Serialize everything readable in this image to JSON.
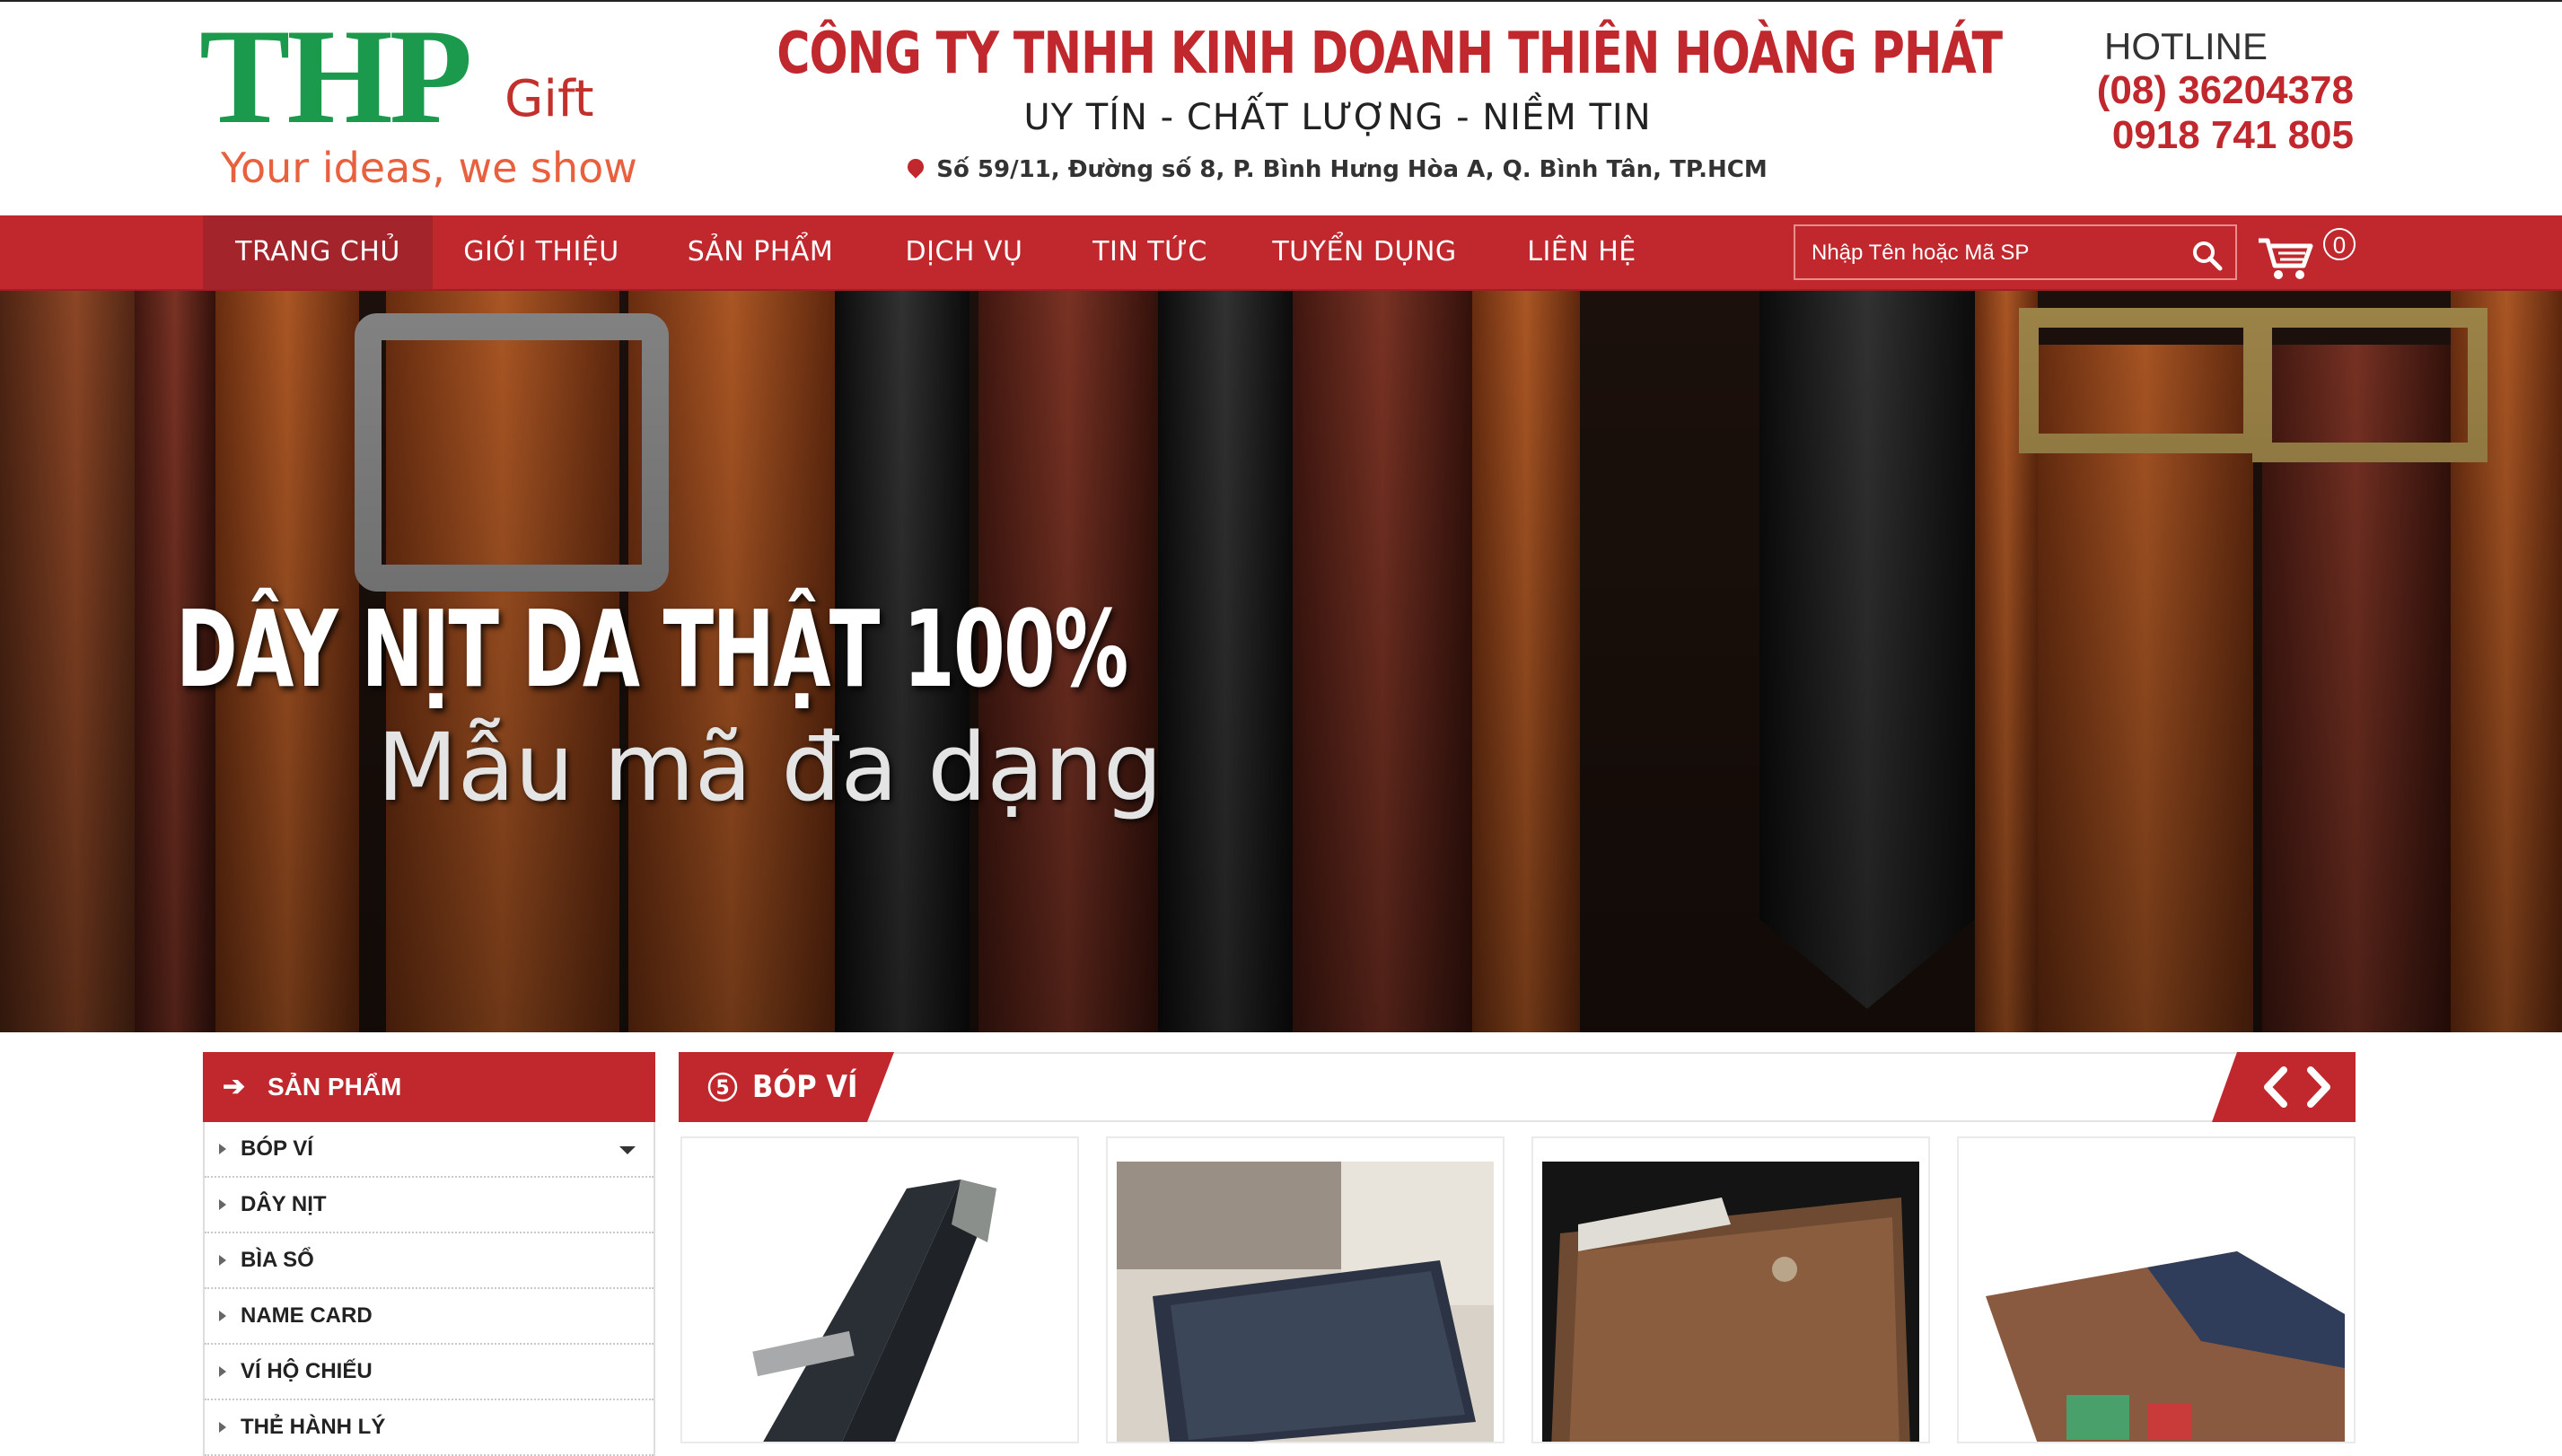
{
  "header": {
    "logo": {
      "main": "THP",
      "suffix": "Gift",
      "tagline": "Your ideas, we show"
    },
    "company_name": "CÔNG TY TNHH KINH DOANH THIÊN HOÀNG PHÁT",
    "motto": "UY TÍN - CHẤT LƯỢNG - NIỀM TIN",
    "address": "Số 59/11, Đường số 8, P. Bình Hưng Hòa A, Q. Bình Tân, TP.HCM",
    "hotline_label": "HOTLINE",
    "phones": [
      "(08) 36204378",
      "0918 741 805"
    ]
  },
  "nav": {
    "items": [
      {
        "label": "TRANG CHỦ",
        "active": true
      },
      {
        "label": "GIỚI THIỆU"
      },
      {
        "label": "SẢN PHẨM"
      },
      {
        "label": "DỊCH VỤ"
      },
      {
        "label": "TIN TỨC"
      },
      {
        "label": "TUYỂN DỤNG"
      },
      {
        "label": "LIÊN HỆ"
      }
    ],
    "search_placeholder": "Nhập Tên hoặc Mã SP",
    "cart_count": "0"
  },
  "banner": {
    "title": "DÂY NỊT DA THẬT 100%",
    "subtitle": "Mẫu mã đa dạng"
  },
  "sidebar": {
    "heading": "SẢN PHẨM",
    "items": [
      {
        "label": "BÓP VÍ",
        "has_dropdown": true
      },
      {
        "label": "DÂY NỊT"
      },
      {
        "label": "BÌA SỔ"
      },
      {
        "label": "NAME CARD"
      },
      {
        "label": "VÍ HỘ CHIẾU"
      },
      {
        "label": "THẺ HÀNH LÝ"
      }
    ]
  },
  "products": {
    "section_title": "BÓP VÍ",
    "section_number_icon": "number-5-icon",
    "cards": [
      {
        "image": "black-money-clip-wallet"
      },
      {
        "image": "denim-wallet-with-magazines"
      },
      {
        "image": "brown-leather-wallet-railway"
      },
      {
        "image": "brown-denim-wallet-open"
      }
    ]
  },
  "colors": {
    "brand_red": "#c0282d",
    "logo_green": "#1b9a4e",
    "tagline_orange": "#e8603d"
  }
}
